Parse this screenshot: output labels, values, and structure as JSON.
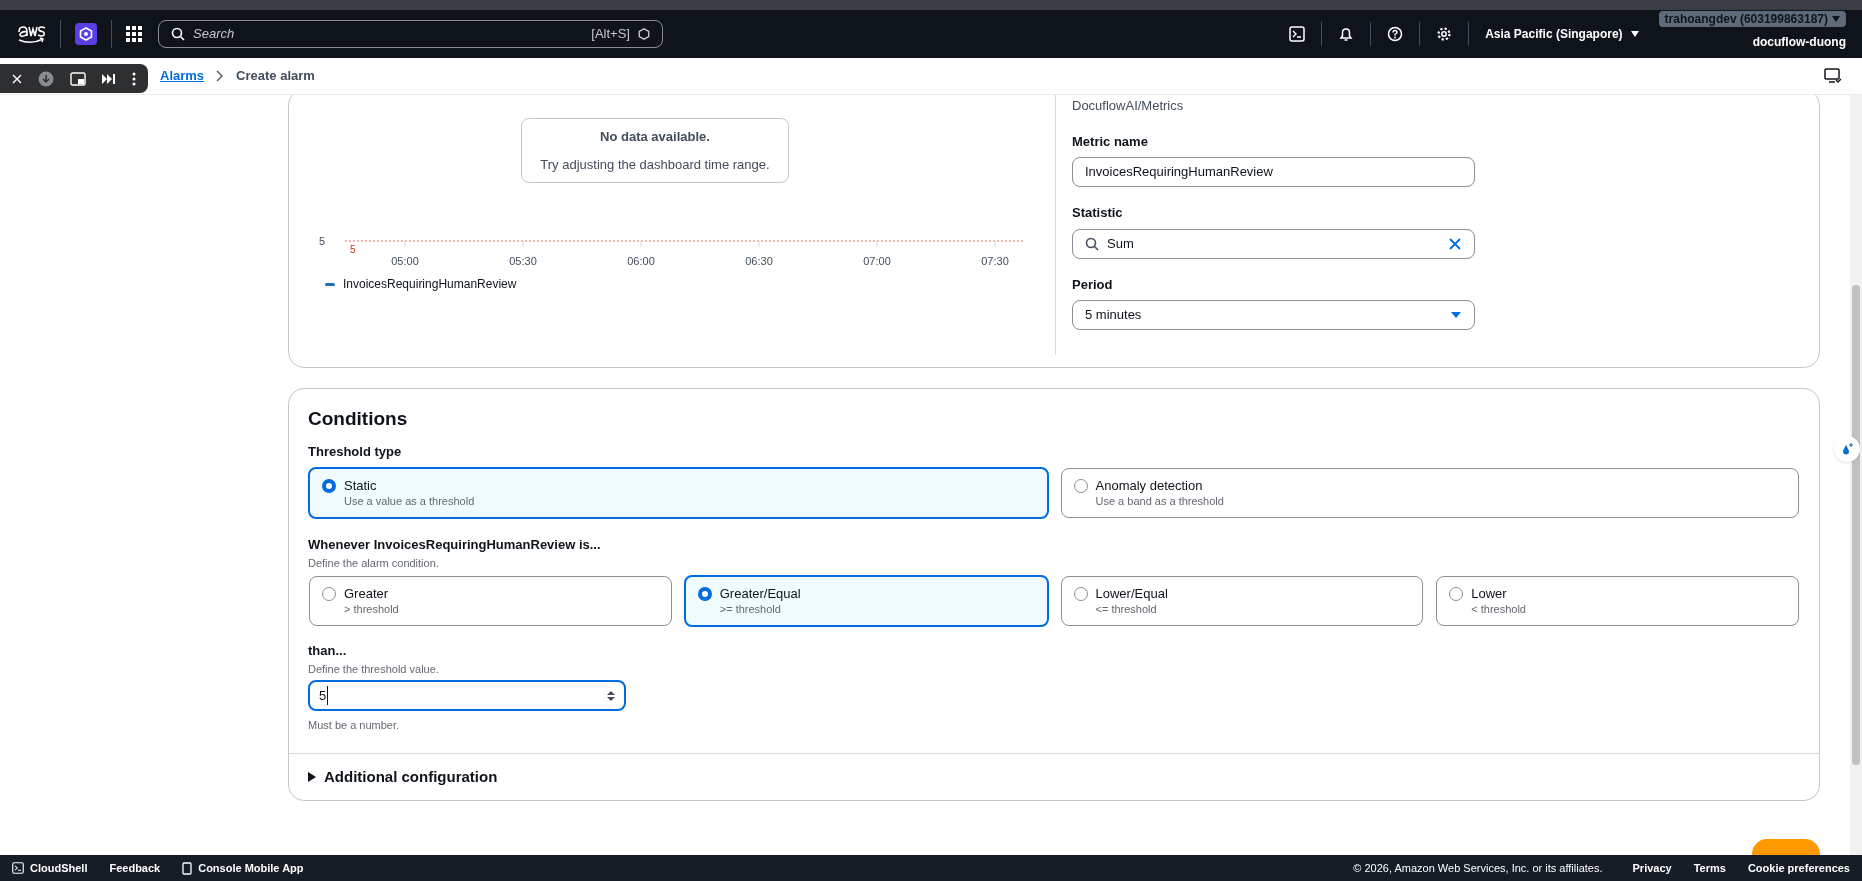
{
  "top_nav": {
    "search": {
      "placeholder": "Search",
      "shortcut": "[Alt+S]"
    },
    "region": "Asia Pacific (Singapore)",
    "account": "trahoangdev (603199863187)",
    "account_alias": "docuflow-duong"
  },
  "breadcrumbs": [
    {
      "label": "Alarms",
      "kind": "link"
    },
    {
      "label": "Create alarm",
      "kind": "current"
    }
  ],
  "metric_panel": {
    "chart": {
      "no_data_title": "No data available.",
      "no_data_hint": "Try adjusting the dashboard time range.",
      "legend": "InvoicesRequiringHumanReview",
      "y_axis_label": "5",
      "threshold_label": "5",
      "x_axis_labels": [
        "05:00",
        "05:30",
        "06:00",
        "06:30",
        "07:00",
        "07:30"
      ]
    },
    "namespace": "DocuflowAI/Metrics",
    "fields": [
      {
        "kind": "text",
        "label": "Metric name",
        "value": "InvoicesRequiringHumanReview"
      },
      {
        "kind": "search",
        "label": "Statistic",
        "value": "Sum"
      },
      {
        "kind": "select",
        "label": "Period",
        "value": "5 minutes"
      }
    ]
  },
  "conditions": {
    "title": "Conditions",
    "threshold_type": {
      "label": "Threshold type",
      "options": [
        {
          "label": "Static",
          "hint": "Use a value as a threshold",
          "selected": true
        },
        {
          "label": "Anomaly detection",
          "hint": "Use a band as a threshold",
          "selected": false
        }
      ]
    },
    "whenever": {
      "label": "Whenever InvoicesRequiringHumanReview is...",
      "description": "Define the alarm condition.",
      "options": [
        {
          "label": "Greater",
          "hint": "> threshold",
          "selected": false
        },
        {
          "label": "Greater/Equal",
          "hint": ">= threshold",
          "selected": true
        },
        {
          "label": "Lower/Equal",
          "hint": "<= threshold",
          "selected": false
        },
        {
          "label": "Lower",
          "hint": "< threshold",
          "selected": false
        }
      ]
    },
    "than": {
      "label": "than...",
      "description": "Define the threshold value.",
      "value": "5",
      "help": "Must be a number."
    },
    "additional": {
      "label": "Additional configuration",
      "expanded": false
    }
  },
  "footer": {
    "left": [
      "CloudShell",
      "Feedback",
      "Console Mobile App"
    ],
    "copyright": "© 2026, Amazon Web Services, Inc. or its affiliates.",
    "right": [
      "Privacy",
      "Terms",
      "Cookie preferences"
    ]
  }
}
